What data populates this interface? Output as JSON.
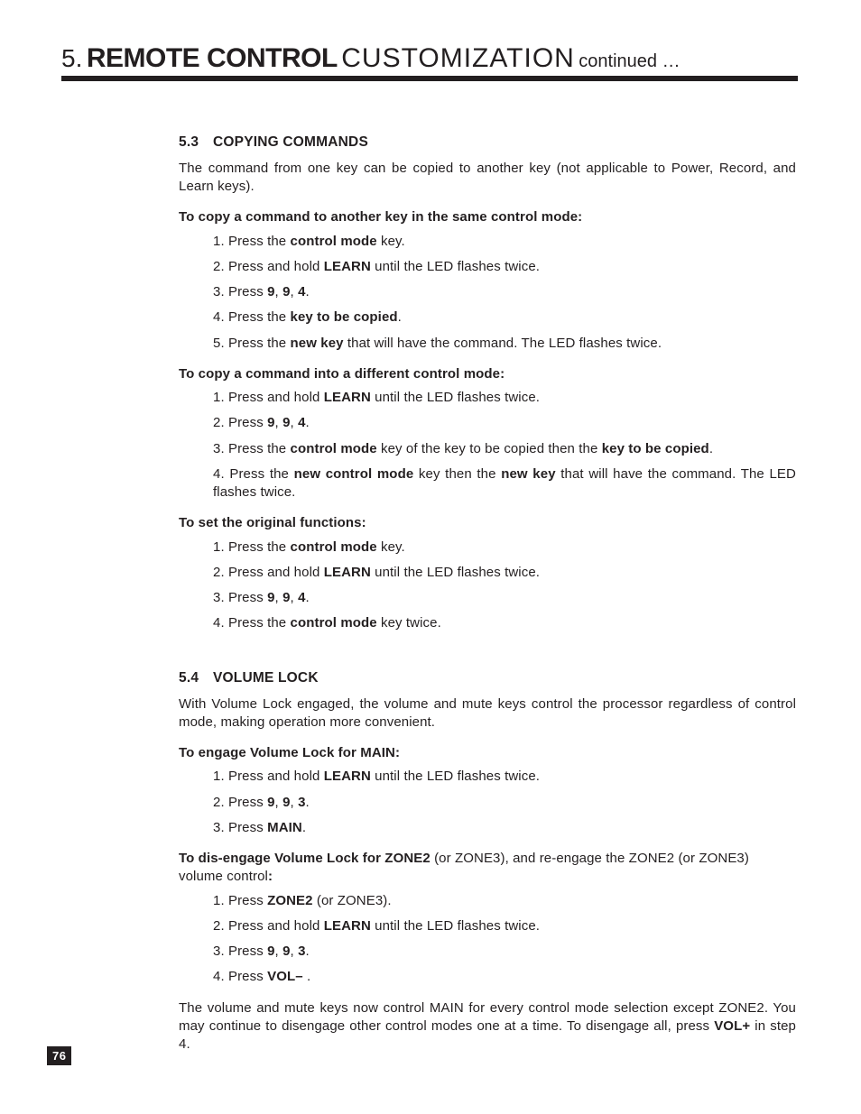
{
  "header": {
    "num": "5.",
    "bold": "REMOTE CONTROL",
    "light": "CUSTOMIZATION",
    "cont": "continued …"
  },
  "page_number": "76",
  "s53": {
    "num": "5.3",
    "title": "COPYING COMMANDS",
    "intro": "The command from one key can be copied to another key (not applicable to Power, Record, and Learn keys).",
    "sub_a": "To copy a command to another key in the same control mode:",
    "a1_pre": "1. Press the ",
    "a1_b": "control mode",
    "a1_post": " key.",
    "a2_pre": "2. Press and hold ",
    "a2_b": "LEARN",
    "a2_post": " until the LED flashes twice.",
    "a3_pre": "3. Press ",
    "a3_b1": "9",
    "a3_sep1": ", ",
    "a3_b2": "9",
    "a3_sep2": ", ",
    "a3_b3": "4",
    "a3_post": ".",
    "a4_pre": "4. Press the ",
    "a4_b": "key to be copied",
    "a4_post": ".",
    "a5_pre": "5. Press the ",
    "a5_b": "new key",
    "a5_post": " that will have the command. The LED flashes twice.",
    "sub_b": "To copy a command into a different control mode:",
    "b1_pre": "1. Press and hold ",
    "b1_b": "LEARN",
    "b1_post": " until the LED flashes twice.",
    "b2_pre": "2. Press ",
    "b2_b1": "9",
    "b2_sep1": ", ",
    "b2_b2": "9",
    "b2_sep2": ", ",
    "b2_b3": "4",
    "b2_post": ".",
    "b3_pre": "3. Press the ",
    "b3_b1": "control mode",
    "b3_mid": " key of the key to be copied then the ",
    "b3_b2": "key to be copied",
    "b3_post": ".",
    "b4_pre": "4. Press the ",
    "b4_b1": "new control mode",
    "b4_mid": " key then the ",
    "b4_b2": "new key",
    "b4_post": " that will have the command. The LED flashes twice.",
    "sub_c": "To set the original functions:",
    "c1_pre": "1. Press the ",
    "c1_b": "control mode",
    "c1_post": " key.",
    "c2_pre": "2. Press and hold ",
    "c2_b": "LEARN",
    "c2_post": " until the LED flashes twice.",
    "c3_pre": "3. Press ",
    "c3_b1": "9",
    "c3_sep1": ", ",
    "c3_b2": "9",
    "c3_sep2": ", ",
    "c3_b3": "4",
    "c3_post": ".",
    "c4_pre": "4. Press the ",
    "c4_b": "control mode",
    "c4_post": " key twice."
  },
  "s54": {
    "num": "5.4",
    "title": "VOLUME LOCK",
    "intro": "With Volume Lock engaged, the volume and mute keys control the processor regardless of control mode, making operation more convenient.",
    "sub_a": "To engage Volume Lock for MAIN:",
    "a1_pre": "1. Press and hold ",
    "a1_b": "LEARN",
    "a1_post": " until the LED flashes twice.",
    "a2_pre": "2. Press ",
    "a2_b1": "9",
    "a2_sep1": ", ",
    "a2_b2": "9",
    "a2_sep2": ", ",
    "a2_b3": "3",
    "a2_post": ".",
    "a3_pre": "3. Press ",
    "a3_b": "MAIN",
    "a3_post": ".",
    "sub_b_b": "To dis-engage Volume Lock for ZONE2",
    "sub_b_rest": " (or ZONE3), and re-engage the ZONE2 (or ZONE3) volume control",
    "sub_b_colon": ":",
    "b1_pre": "1. Press ",
    "b1_b": "ZONE2",
    "b1_post": " (or ZONE3).",
    "b2_pre": "2. Press and hold ",
    "b2_b": "LEARN",
    "b2_post": " until the LED flashes twice.",
    "b3_pre": "3. Press ",
    "b3_b1": "9",
    "b3_sep1": ", ",
    "b3_b2": "9",
    "b3_sep2": ", ",
    "b3_b3": "3",
    "b3_post": ".",
    "b4_pre": "4. Press ",
    "b4_b": "VOL–",
    "b4_post": " .",
    "outro_pre": "The volume and mute keys now control MAIN for every control mode selection except ZONE2. You may continue to disengage other control modes one at a time. To disengage all, press ",
    "outro_b": "VOL+",
    "outro_post": " in step 4."
  }
}
